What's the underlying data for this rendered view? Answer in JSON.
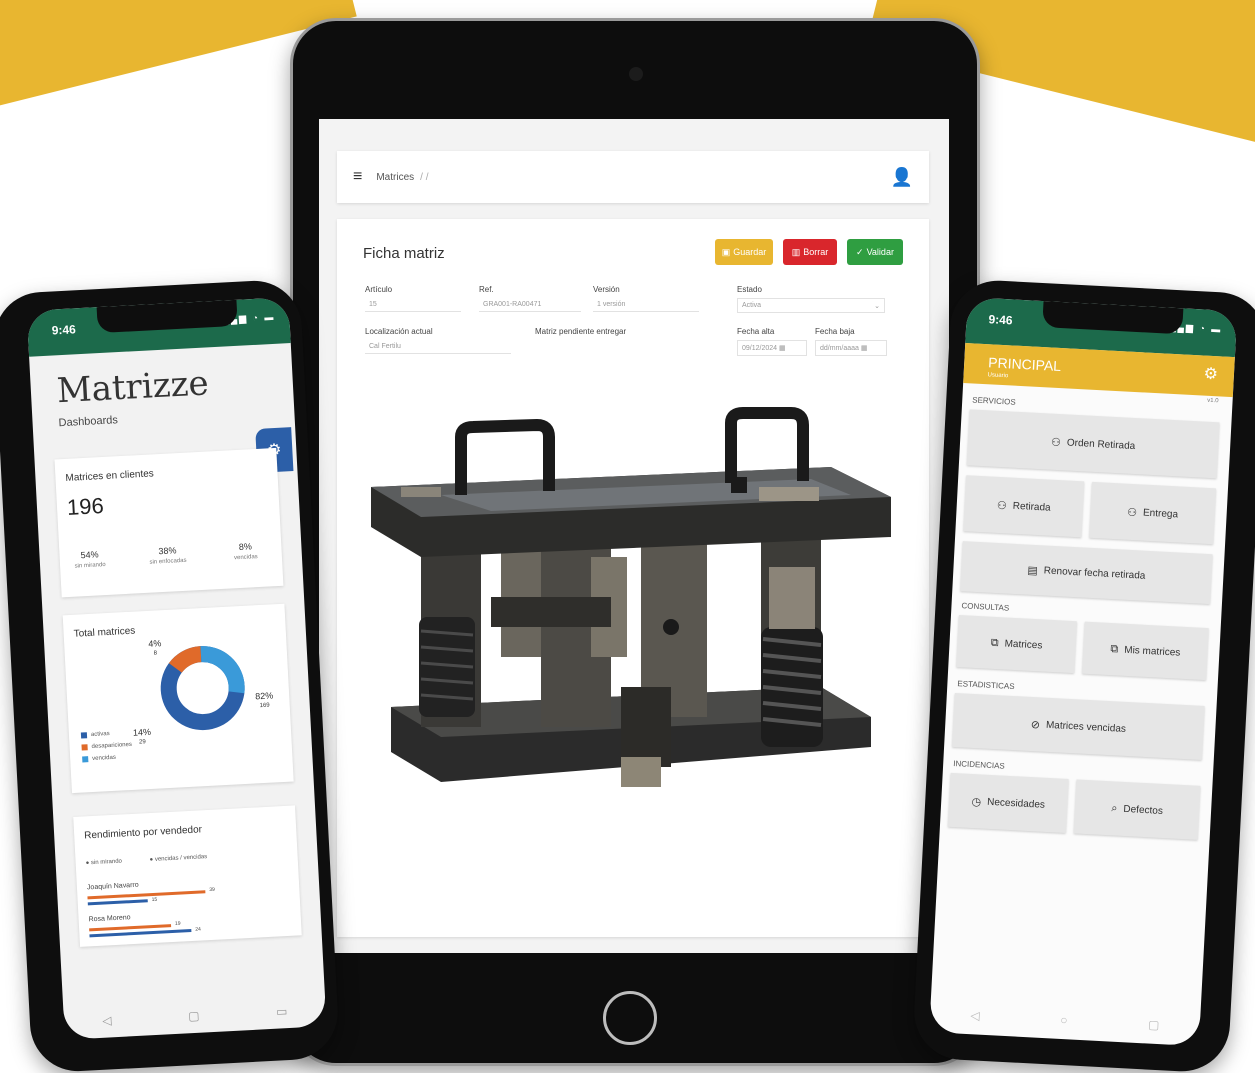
{
  "tablet": {
    "appbar": {
      "menu_icon": "≡",
      "breadcrumb": "Matrices",
      "breadcrumb_sep": "/ /",
      "user_icon": "👤"
    },
    "form": {
      "title": "Ficha matriz",
      "buttons": {
        "save": "Guardar",
        "delete": "Borrar",
        "ok": "Validar"
      },
      "fields": {
        "articulo": {
          "label": "Artículo",
          "value": "15"
        },
        "ref": {
          "label": "Ref.",
          "value": "GRA001-RA00471"
        },
        "version": {
          "label": "Versión",
          "value": "1 versión"
        },
        "estado": {
          "label": "Estado",
          "value": "Activa"
        },
        "localizacion": {
          "label": "Localización actual",
          "value": "Cal Fertilu"
        },
        "matriz_pendiente": {
          "label": "Matriz pendiente entregar",
          "value": ""
        },
        "fecha_alta": {
          "label": "Fecha alta",
          "value": "09/12/2024"
        },
        "fecha_baja": {
          "label": "Fecha baja",
          "value": "dd/mm/aaaa"
        }
      }
    }
  },
  "phone_left": {
    "time": "9:46",
    "status_icons": "▂▄▆ ◔ ▬",
    "logo": "Matrizze",
    "subtitle": "Dashboards",
    "fab_icon": "⚙",
    "card_clients": {
      "title": "Matrices en clientes",
      "total": "196",
      "stats": [
        {
          "value": "54%",
          "label": "sin mirando"
        },
        {
          "value": "38%",
          "label": "sin enfocadas"
        },
        {
          "value": "8%",
          "label": "vencidas"
        }
      ]
    },
    "card_total": {
      "title": "Total matrices",
      "legend": [
        {
          "label": "activas",
          "color": "#2c5fa8"
        },
        {
          "label": "desapariciones",
          "color": "#e06a2a"
        },
        {
          "label": "vencidas",
          "color": "#3a9ad9"
        }
      ],
      "labels": {
        "a": {
          "pct": "82%",
          "count": "169"
        },
        "b": {
          "pct": "14%",
          "count": "29"
        },
        "c": {
          "pct": "4%",
          "count": "8"
        }
      }
    },
    "card_vendor": {
      "title": "Rendimiento por vendedor",
      "legend": [
        "● sin mirando",
        "● vencidas / vencidas"
      ],
      "rows": [
        {
          "name": "Joaquín Navarro",
          "a": "39",
          "b": "15"
        },
        {
          "name": "Rosa Moreno",
          "a": "19",
          "b": "24"
        }
      ]
    },
    "nav": {
      "back": "◁",
      "home": "▢",
      "recent": "▭"
    }
  },
  "phone_right": {
    "time": "9:46",
    "status_icons": "▂▄▆ ◔ ▬",
    "header_title": "PRINCIPAL",
    "header_sub": "Usuario",
    "gear_icon": "⚙",
    "version": "v1.0",
    "sections": {
      "servicios": "SERVICIOS",
      "consultas": "CONSULTAS",
      "estadisticas": "ESTADISTICAS",
      "incidencias": "INCIDENCIAS"
    },
    "buttons": {
      "orden_retirada": "Orden Retirada",
      "retirada": "Retirada",
      "entrega": "Entrega",
      "renovar": "Renovar fecha retirada",
      "matrices": "Matrices",
      "mis_matrices": "Mis matrices",
      "vencidas": "Matrices vencidas",
      "necesidades": "Necesidades",
      "defectos": "Defectos"
    },
    "icons": {
      "user": "⚇",
      "calendar": "▤",
      "copy": "⧉",
      "check": "⊘",
      "clock": "◷",
      "search": "⌕"
    },
    "nav": {
      "back": "◁",
      "home": "○",
      "recent": "▢"
    }
  }
}
